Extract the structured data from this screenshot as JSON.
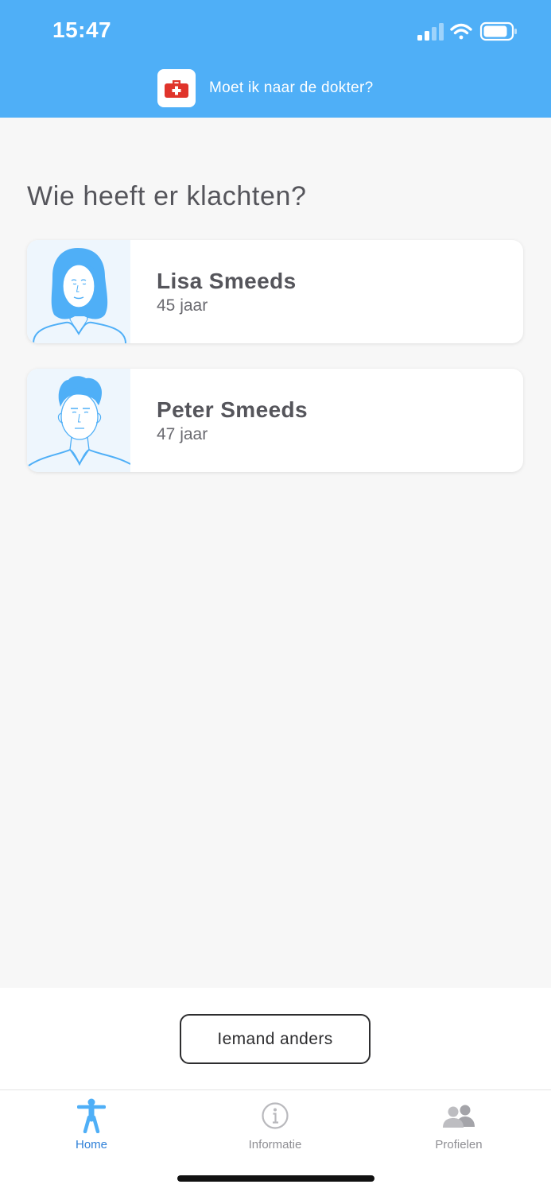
{
  "status_bar": {
    "time": "15:47"
  },
  "header": {
    "title": "Moet ik naar de dokter?",
    "icon": "first-aid-kit-icon"
  },
  "main": {
    "question": "Wie heeft er klachten?",
    "profiles": [
      {
        "name": "Lisa Smeeds",
        "age": "45 jaar",
        "avatar": "female-face-icon"
      },
      {
        "name": "Peter Smeeds",
        "age": "47 jaar",
        "avatar": "male-face-icon"
      }
    ],
    "other_button": "Iemand anders"
  },
  "tabbar": {
    "tabs": [
      {
        "label": "Home",
        "icon": "person-figure-icon",
        "active": true
      },
      {
        "label": "Informatie",
        "icon": "info-icon",
        "active": false
      },
      {
        "label": "Profielen",
        "icon": "people-icon",
        "active": false
      }
    ]
  },
  "colors": {
    "header": "#4faff7",
    "accent": "#2f80d8",
    "logo_red": "#e0342b"
  }
}
